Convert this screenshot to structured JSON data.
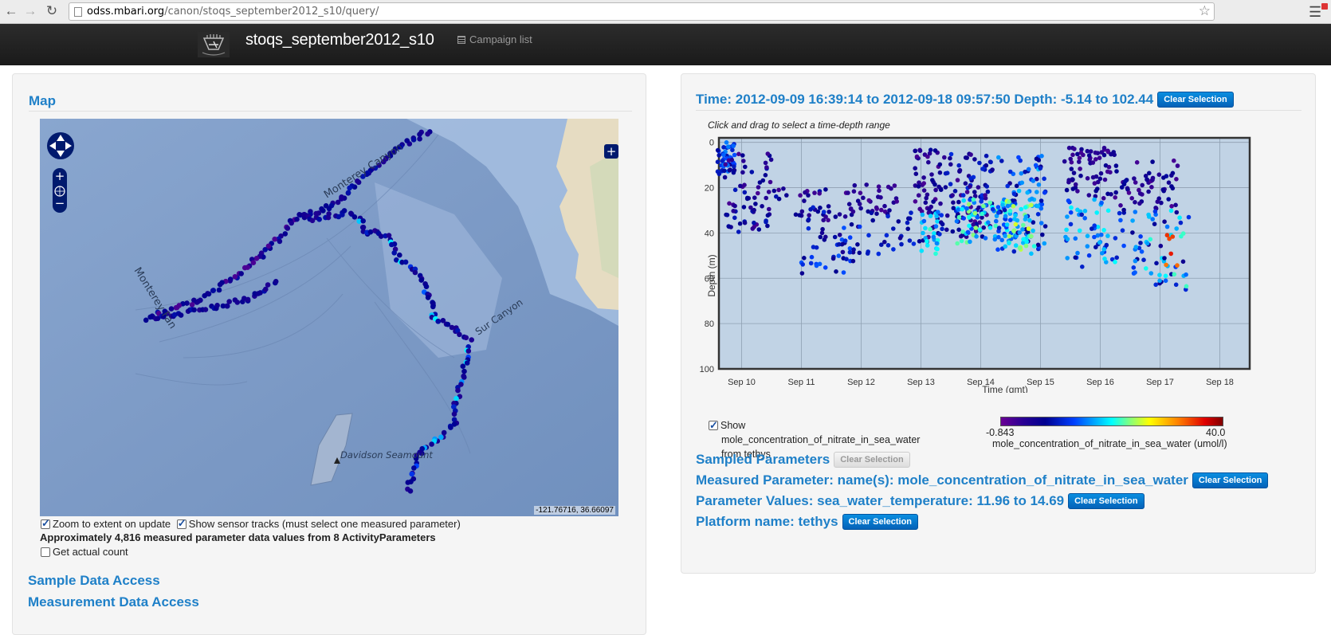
{
  "browser": {
    "url_host": "odss.mbari.org",
    "url_path": "/canon/stoqs_september2012_s10/query/"
  },
  "header": {
    "title": "stoqs_september2012_s10",
    "campaign_link": "Campaign list"
  },
  "map_panel": {
    "heading": "Map",
    "labels": {
      "monterey_canyon": "Monterey Canyon",
      "monterey_fan": "Monterey Fan",
      "sur_canyon": "Sur Canyon",
      "davidson": "Davidson Seamount"
    },
    "coordinates": "-121.76716, 36.66097",
    "zoom_option": "Zoom to extent on update",
    "tracks_option": "Show sensor tracks (must select one measured parameter)",
    "approx_text": "Approximately 4,816 measured parameter data values from 8 ActivityParameters",
    "actual_count": "Get actual count",
    "sample_access": "Sample Data Access",
    "measurement_access": "Measurement Data Access"
  },
  "plot_panel": {
    "time_heading": "Time: 2012-09-09 16:39:14 to 2012-09-18 09:57:50 Depth: -5.14 to 102.44",
    "clear_label": "Clear Selection",
    "hint": "Click and drag to select a time-depth range",
    "show_label": "Show",
    "show_param": "mole_concentration_of_nitrate_in_sea_water",
    "show_from": "from tethys",
    "colorbar_min": "-0.843",
    "colorbar_max": "40.0",
    "colorbar_label": "mole_concentration_of_nitrate_in_sea_water (umol/l)",
    "sampled_parameters": "Sampled Parameters",
    "measured_parameter": "Measured Parameter: name(s): mole_concentration_of_nitrate_in_sea_water",
    "parameter_values": "Parameter Values: sea_water_temperature: 11.96 to 14.69",
    "platform_name": "Platform name: tethys"
  },
  "colors": {
    "accent": "#1f80c8",
    "plot_bg": "#c1d3e5"
  },
  "chart_data": {
    "type": "scatter",
    "xlabel": "Time (gmt)",
    "ylabel": "Depth (m)",
    "x_tick_labels": [
      "Sep 10",
      "Sep 11",
      "Sep 12",
      "Sep 13",
      "Sep 14",
      "Sep 15",
      "Sep 16",
      "Sep 17",
      "Sep 18"
    ],
    "y_tick_labels": [
      "0",
      "20",
      "40",
      "60",
      "80",
      "100"
    ],
    "xlim": [
      9.62,
      18.5
    ],
    "ylim": [
      100,
      -2
    ],
    "grid": true,
    "colormap": "jet",
    "color_range": [
      -0.843,
      40.0
    ],
    "clusters": [
      {
        "t": [
          9.6,
          9.9
        ],
        "d": [
          0,
          14
        ],
        "c": [
          0.2,
          0.4
        ],
        "n": 40
      },
      {
        "t": [
          9.7,
          10.5
        ],
        "d": [
          5,
          40
        ],
        "c": [
          0.05,
          0.25
        ],
        "n": 70
      },
      {
        "t": [
          10.5,
          11.5
        ],
        "d": [
          20,
          35
        ],
        "c": [
          0.05,
          0.25
        ],
        "n": 30
      },
      {
        "t": [
          11.0,
          12.0
        ],
        "d": [
          28,
          58
        ],
        "c": [
          0.12,
          0.38
        ],
        "n": 55
      },
      {
        "t": [
          11.7,
          12.6
        ],
        "d": [
          18,
          33
        ],
        "c": [
          0.05,
          0.18
        ],
        "n": 35
      },
      {
        "t": [
          12.1,
          12.9
        ],
        "d": [
          30,
          50
        ],
        "c": [
          0.15,
          0.3
        ],
        "n": 25
      },
      {
        "t": [
          12.9,
          13.3
        ],
        "d": [
          2,
          45
        ],
        "c": [
          0.05,
          0.22
        ],
        "n": 55
      },
      {
        "t": [
          13.0,
          13.3
        ],
        "d": [
          30,
          50
        ],
        "c": [
          0.35,
          0.55
        ],
        "n": 25
      },
      {
        "t": [
          13.3,
          14.2
        ],
        "d": [
          5,
          42
        ],
        "c": [
          0.05,
          0.3
        ],
        "n": 110
      },
      {
        "t": [
          13.6,
          14.6
        ],
        "d": [
          25,
          45
        ],
        "c": [
          0.3,
          0.6
        ],
        "n": 80
      },
      {
        "t": [
          14.2,
          15.1
        ],
        "d": [
          5,
          50
        ],
        "c": [
          0.15,
          0.45
        ],
        "n": 90
      },
      {
        "t": [
          14.4,
          14.9
        ],
        "d": [
          20,
          48
        ],
        "c": [
          0.4,
          0.65
        ],
        "n": 40
      },
      {
        "t": [
          15.4,
          16.3
        ],
        "d": [
          2,
          25
        ],
        "c": [
          0.05,
          0.2
        ],
        "n": 70
      },
      {
        "t": [
          15.4,
          16.4
        ],
        "d": [
          25,
          55
        ],
        "c": [
          0.2,
          0.5
        ],
        "n": 60
      },
      {
        "t": [
          16.3,
          17.3
        ],
        "d": [
          8,
          30
        ],
        "c": [
          0.05,
          0.22
        ],
        "n": 55
      },
      {
        "t": [
          16.5,
          17.5
        ],
        "d": [
          30,
          65
        ],
        "c": [
          0.15,
          0.55
        ],
        "n": 60
      },
      {
        "t": [
          17.1,
          17.3
        ],
        "d": [
          40,
          55
        ],
        "c": [
          0.75,
          0.9
        ],
        "n": 6
      }
    ]
  }
}
